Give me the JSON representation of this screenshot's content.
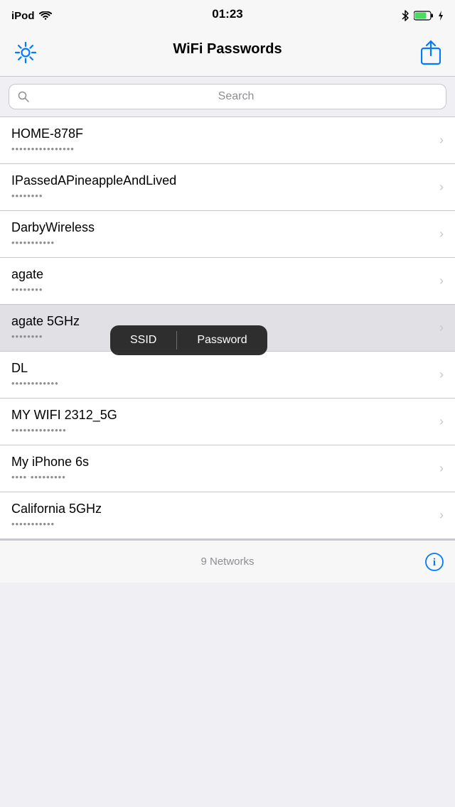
{
  "statusBar": {
    "carrier": "iPod",
    "time": "01:23",
    "batteryLevel": 80
  },
  "navBar": {
    "title": "WiFi Passwords",
    "gearLabel": "Settings",
    "shareLabel": "Share"
  },
  "search": {
    "placeholder": "Search"
  },
  "networks": [
    {
      "name": "HOME-878F",
      "password": "••••••••••••••••"
    },
    {
      "name": "IPassedAPineappleAndLived",
      "password": "••••••••"
    },
    {
      "name": "DarbyWireless",
      "password": "•••••••••••"
    },
    {
      "name": "agate",
      "password": "••••••••"
    },
    {
      "name": "agate 5GHz",
      "password": "••••••••",
      "highlighted": true
    },
    {
      "name": "DL",
      "password": "••••••••••••"
    },
    {
      "name": "MY WIFI 2312_5G",
      "password": "••••••••••••••"
    },
    {
      "name": "My iPhone 6s",
      "password": "•••• •••••••••"
    },
    {
      "name": "California 5GHz",
      "password": "•••••••••••"
    }
  ],
  "tooltip": {
    "ssidLabel": "SSID",
    "passwordLabel": "Password"
  },
  "footer": {
    "networksCount": "9 Networks"
  }
}
